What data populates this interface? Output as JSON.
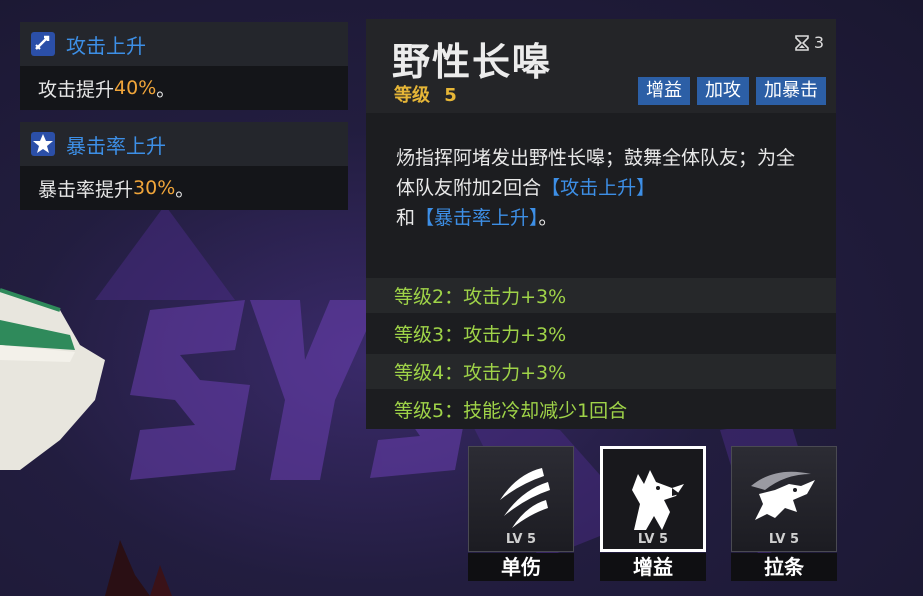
{
  "buffs": [
    {
      "title": "攻击上升",
      "desc_prefix": "攻击提升",
      "desc_value": "40%",
      "desc_suffix": "。",
      "icon": "sword-up-icon"
    },
    {
      "title": "暴击率上升",
      "desc_prefix": "暴击率提升",
      "desc_value": "30%",
      "desc_suffix": "。",
      "icon": "crit-up-icon"
    }
  ],
  "skill": {
    "name": "野性长嗥",
    "level_label": "等级",
    "level_value": "5",
    "cooldown": "3",
    "tags": [
      "增益",
      "加攻",
      "加暴击"
    ],
    "desc_a": "炀指挥阿堵发出野性长嗥；鼓舞全体队友；为全体队友附加2回合",
    "desc_kw1": "【攻击上升】",
    "desc_b": "和",
    "desc_kw2": "【暴击率上升】",
    "desc_c": "。",
    "level_effects": [
      "等级2：攻击力+3%",
      "等级3：攻击力+3%",
      "等级4：攻击力+3%",
      "等级5：技能冷却减少1回合"
    ]
  },
  "skill_buttons": [
    {
      "lv": "LV 5",
      "label": "单伤",
      "icon": "claw-slash-icon",
      "selected": false
    },
    {
      "lv": "LV 5",
      "label": "增益",
      "icon": "howling-wolf-icon",
      "selected": true
    },
    {
      "lv": "LV 5",
      "label": "拉条",
      "icon": "wolf-dash-icon",
      "selected": false
    }
  ],
  "colors": {
    "accent_blue": "#3d8fe6",
    "highlight_orange": "#f0a53a",
    "level_gold": "#e6b637",
    "level_green": "#9fd348",
    "tag_bg": "#2c5fa6"
  }
}
